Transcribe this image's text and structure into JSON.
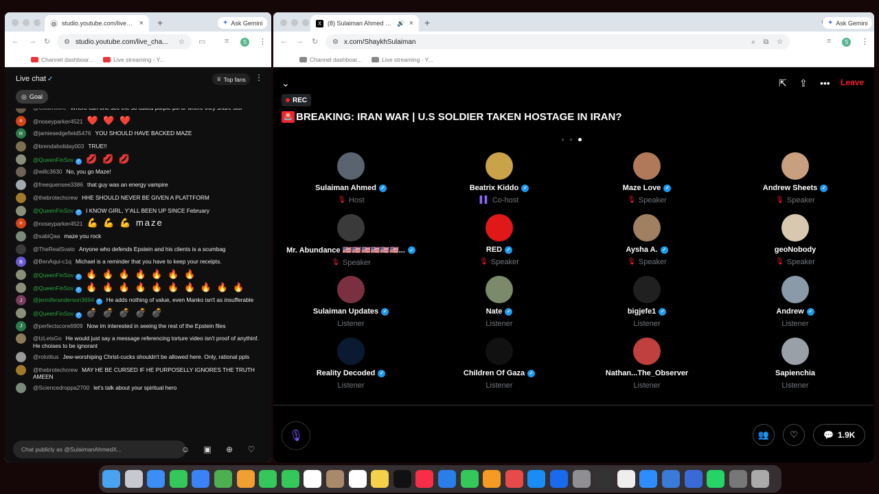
{
  "left_window": {
    "tab_title": "studio.youtube.com/live_chat",
    "url": "studio.youtube.com/live_cha...",
    "ask_gemini": "Ask Gemini",
    "profile_initial": "S",
    "bookmarks": [
      "Channel dashboar...",
      "Live streaming - Y..."
    ]
  },
  "live_chat": {
    "title": "Live chat",
    "top_fans": "Top fans",
    "goal": "Goal",
    "input_placeholder": "Chat publicly as @SulaimanAhmedX...",
    "messages": [
      {
        "avatar": "#6b5a4a",
        "letter": "",
        "name": "@CoachJore",
        "green": false,
        "verified": false,
        "text": "Where can one see the so called purple pill or where they share stuf",
        "big": false
      },
      {
        "avatar": "#d64517",
        "letter": "n",
        "name": "@noseyparker4521",
        "green": false,
        "verified": false,
        "text": "❤️ ❤️ ❤️",
        "big": true
      },
      {
        "avatar": "#2b7a4b",
        "letter": "R",
        "name": "@jamiesedgefield5476",
        "green": false,
        "verified": false,
        "text": "YOU SHOULD HAVE BACKED MAZE",
        "big": false
      },
      {
        "avatar": "#7b6f52",
        "letter": "",
        "name": "@brendaholiday003",
        "green": false,
        "verified": false,
        "text": "TRUE!!",
        "big": false
      },
      {
        "avatar": "#8a8f7a",
        "letter": "",
        "name": "@QueenFinSov",
        "green": true,
        "verified": true,
        "text": "💋 💋 💋",
        "big": true
      },
      {
        "avatar": "#6d6255",
        "letter": "",
        "name": "@willc3630",
        "green": false,
        "verified": false,
        "text": "No, you go Maze!",
        "big": false
      },
      {
        "avatar": "#a3a9b0",
        "letter": "",
        "name": "@freequensee3386",
        "green": false,
        "verified": false,
        "text": "that guy was an energy vampire",
        "big": false
      },
      {
        "avatar": "#a07a2a",
        "letter": "",
        "name": "@thebrotechcrew",
        "green": false,
        "verified": false,
        "text": "HHE SHOULD NEVER BE GIVEN A PLATTFORM",
        "big": false
      },
      {
        "avatar": "#8a8f7a",
        "letter": "",
        "name": "@QueenFinSov",
        "green": true,
        "verified": true,
        "text": "I KNOW GIRL, Y'ALL BEEN UP SINCE February",
        "big": false
      },
      {
        "avatar": "#d64517",
        "letter": "n",
        "name": "@noseyparker4521",
        "green": false,
        "verified": false,
        "text": "💪 💪 💪  maze",
        "big": true
      },
      {
        "avatar": "#7a8a7a",
        "letter": "",
        "name": "@sabiQaa",
        "green": false,
        "verified": false,
        "text": "maze you rock",
        "big": false
      },
      {
        "avatar": "#3a3a3a",
        "letter": "",
        "name": "@TheRealSvato",
        "green": false,
        "verified": false,
        "text": "Anyone who defends Epstein and his clients is a scumbag",
        "big": false
      },
      {
        "avatar": "#6a5acd",
        "letter": "B",
        "name": "@BenAqui-c1q",
        "green": false,
        "verified": false,
        "text": "Michael is a reminder that you have to keep your receipts.",
        "big": false
      },
      {
        "avatar": "#8a8f7a",
        "letter": "",
        "name": "@QueenFinSov",
        "green": true,
        "verified": true,
        "text": "🔥 🔥 🔥 🔥 🔥 🔥 🔥",
        "big": true
      },
      {
        "avatar": "#8a8f7a",
        "letter": "",
        "name": "@QueenFinSov",
        "green": true,
        "verified": true,
        "text": "🔥 🔥 🔥 🔥 🔥 🔥 🔥 🔥 🔥 🔥",
        "big": true
      },
      {
        "avatar": "#7a3b5c",
        "letter": "J",
        "name": "@jenniferanderson3694",
        "green": true,
        "verified": true,
        "text": "He adds nothing of value, even Manko isn't as insufferable",
        "big": false
      },
      {
        "avatar": "#8a8f7a",
        "letter": "",
        "name": "@QueenFinSov",
        "green": true,
        "verified": true,
        "text": "💣 💣 💣 💣 💣",
        "big": true
      },
      {
        "avatar": "#2b7a4b",
        "letter": "J",
        "name": "@perfectscore6909",
        "green": false,
        "verified": false,
        "text": "Now im interested in seeing the rest of the Epstein files",
        "big": false
      },
      {
        "avatar": "#8c7a5a",
        "letter": "",
        "name": "@IzLetsGo",
        "green": false,
        "verified": false,
        "text": "He would just say a message referencing torture video isn't proof of anythinf. He choises to be ignorant",
        "big": false
      },
      {
        "avatar": "#9a9a9a",
        "letter": "",
        "name": "@rolotitus",
        "green": false,
        "verified": false,
        "text": "Jew-worshiping Christ-cucks shouldn't be allowed here. Only, rational ppls",
        "big": false
      },
      {
        "avatar": "#a07a2a",
        "letter": "",
        "name": "@thebrotechcrew",
        "green": false,
        "verified": false,
        "text": "MAY HE BE CURSED IF HE PURPOSELLY IGNORES THE TRUTH AMEEN",
        "big": false
      },
      {
        "avatar": "#7a8a7a",
        "letter": "",
        "name": "@Sciencedroppa2700",
        "green": false,
        "verified": false,
        "text": "let's talk about your spiritual hero",
        "big": false
      }
    ]
  },
  "right_window": {
    "tab_title": "(8) Sulaiman Ahmed (@Sh",
    "url": "x.com/ShaykhSulaiman",
    "ask_gemini": "Ask Gemini",
    "profile_initial": "S",
    "bookmarks": [
      "Channel dashboar...",
      "Live streaming - Y..."
    ]
  },
  "space": {
    "rec": "REC",
    "title": "BREAKING: IRAN WAR | U.S SOLDIER TAKEN HOSTAGE IN IRAN?",
    "leave": "Leave",
    "comments_count": "1.9K",
    "participants": [
      {
        "name": "Sulaiman Ahmed",
        "role": "Host",
        "verified": true,
        "color": "#5a6470"
      },
      {
        "name": "Beatrix Kiddo",
        "role": "Co-host",
        "verified": true,
        "color": "#c9a24a"
      },
      {
        "name": "Maze Love",
        "role": "Speaker",
        "verified": true,
        "color": "#b07a5a"
      },
      {
        "name": "Andrew Sheets",
        "role": "Speaker",
        "verified": true,
        "color": "#c8a080"
      },
      {
        "name": "Mr. Abundance 🇺🇸🇺🇸🇺🇸🇺🇸🇺🇸🇺🇸...",
        "role": "Speaker",
        "verified": true,
        "color": "#3a3a3a"
      },
      {
        "name": "RED",
        "role": "Speaker",
        "verified": true,
        "color": "#e01818"
      },
      {
        "name": "Aysha A.",
        "role": "Speaker",
        "verified": true,
        "color": "#a08060"
      },
      {
        "name": "geoNobody",
        "role": "Speaker",
        "verified": false,
        "color": "#d8c8b0"
      },
      {
        "name": "Sulaiman Updates",
        "role": "Listener",
        "verified": true,
        "color": "#7a3040"
      },
      {
        "name": "Nate",
        "role": "Listener",
        "verified": true,
        "color": "#7a8a6a"
      },
      {
        "name": "bigjefe1",
        "role": "Listener",
        "verified": true,
        "color": "#202020"
      },
      {
        "name": "Andrew",
        "role": "Listener",
        "verified": true,
        "color": "#8a9aa8"
      },
      {
        "name": "Reality Decoded",
        "role": "Listener",
        "verified": true,
        "color": "#0a1a30"
      },
      {
        "name": "Children Of Gaza",
        "role": "Listener",
        "verified": true,
        "color": "#111111"
      },
      {
        "name": "Nathan...The_Observer",
        "role": "Listener",
        "verified": false,
        "color": "#c04040"
      },
      {
        "name": "Sapienchia",
        "role": "Listener",
        "verified": false,
        "color": "#9aa0a8"
      }
    ]
  },
  "dock": {
    "apps": [
      "Finder",
      "Launchpad",
      "Safari",
      "Messages",
      "Mail",
      "Maps",
      "Photos",
      "FaceTime",
      "Phone",
      "Calendar",
      "Contacts",
      "Reminders",
      "Notes",
      "TV",
      "Music",
      "Keynote",
      "Numbers",
      "Pages",
      "Dictionary",
      "App Store",
      "Files",
      "System Settings",
      "OBS",
      "Chrome",
      "Zoom",
      "Preview",
      "Quick Look",
      "WhatsApp",
      "Downloads",
      "Trash"
    ],
    "colors": [
      "#4aa3f0",
      "#c8c8d0",
      "#3a8ef5",
      "#34c759",
      "#3b82f6",
      "#4caf50",
      "#f0a030",
      "#34c759",
      "#34c759",
      "#ffffff",
      "#a88a6a",
      "#ffffff",
      "#f5d04a",
      "#111111",
      "#fa2d48",
      "#2a7ee8",
      "#34c759",
      "#f59a23",
      "#e84a4a",
      "#1a8cf5",
      "#1a6af0",
      "#8e8e93",
      "#333333",
      "#eeeeee",
      "#2d8cff",
      "#3a7ad8",
      "#3a6ad8",
      "#25d366",
      "#777777",
      "#aaaaaa"
    ]
  }
}
